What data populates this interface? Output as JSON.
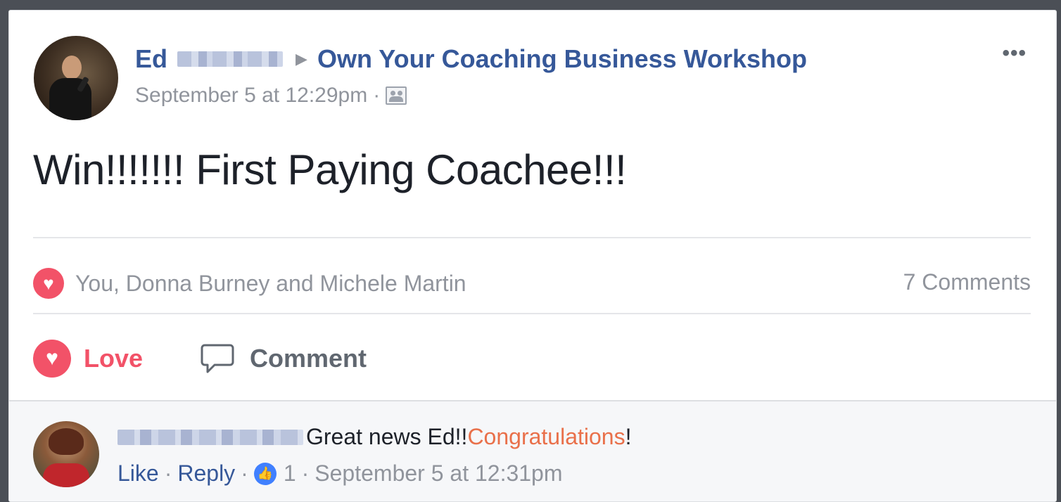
{
  "post": {
    "author_name": "Ed",
    "group_name": "Own Your Coaching Business Workshop",
    "timestamp": "September 5 at 12:29pm",
    "audience_icon": "members-icon",
    "body_text": "Win!!!!!!! First Paying Coachee!!!",
    "more_label": "•••"
  },
  "reactions": {
    "icon": "love-icon",
    "summary": "You, Donna Burney and Michele Martin",
    "comments_count": "7 Comments"
  },
  "actions": {
    "love_label": "Love",
    "comment_label": "Comment"
  },
  "comment": {
    "text_before": "Great news Ed!! ",
    "highlight": "Congratulations",
    "text_after": "!",
    "like_label": "Like",
    "reply_label": "Reply",
    "like_count": "1",
    "timestamp": "September 5 at 12:31pm"
  },
  "colors": {
    "link_blue": "#365899",
    "love_red": "#f25268",
    "muted_gray": "#90949c",
    "highlight_orange": "#e9704a"
  }
}
